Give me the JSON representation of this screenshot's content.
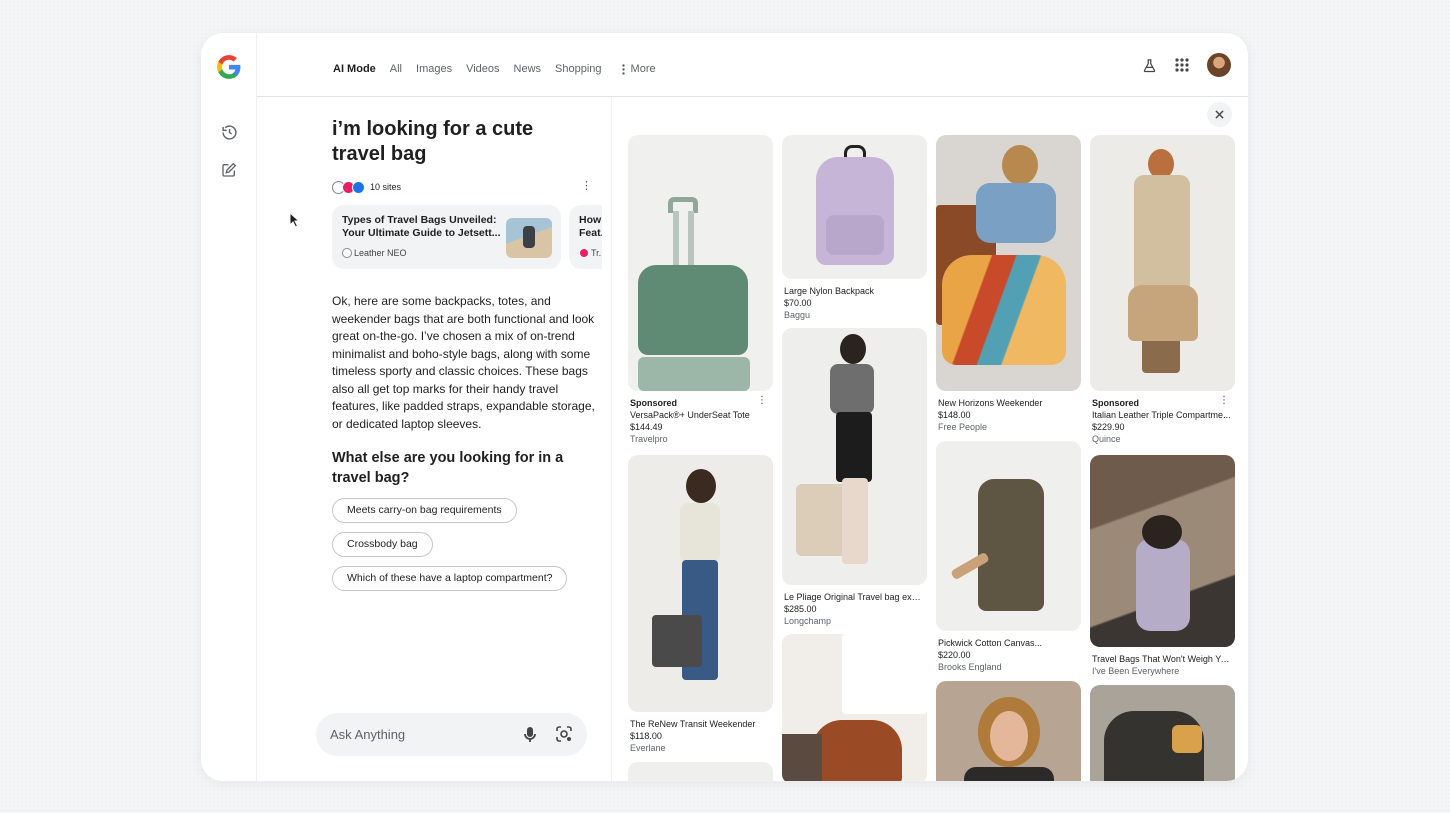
{
  "header": {
    "tabs": [
      {
        "label": "AI Mode",
        "active": true
      },
      {
        "label": "All"
      },
      {
        "label": "Images"
      },
      {
        "label": "Videos"
      },
      {
        "label": "News"
      },
      {
        "label": "Shopping"
      }
    ],
    "more_label": "More"
  },
  "conversation": {
    "query": "i’m looking for a cute travel bag",
    "sites_label": "10 sites",
    "sources": [
      {
        "title": "Types of Travel Bags Unveiled: Your Ultimate Guide to Jetsett...",
        "site": "Leather NEO"
      },
      {
        "title": "How Feat...",
        "site": "Tr..."
      }
    ],
    "answer": "Ok, here are some backpacks, totes, and weekender bags that are both functional and look great on-the-go. I’ve chosen a mix of on-trend minimalist and boho-style bags, along with some timeless sporty and classic choices. These bags also all get top marks for their handy travel features, like padded straps, expandable storage, or dedicated laptop sleeves.",
    "followup_heading": "What else are you looking for in a travel bag?",
    "chips": [
      "Meets carry-on bag requirements",
      "Crossbody bag",
      "Which of these have a laptop compartment?"
    ]
  },
  "askbar": {
    "placeholder": "Ask Anything"
  },
  "products": [
    {
      "sponsored": "Sponsored",
      "name": "VersaPack®+ UnderSeat Tote",
      "price": "$144.49",
      "store": "Travelpro"
    },
    {
      "sponsored": "",
      "name": "The ReNew Transit Weekender",
      "price": "$118.00",
      "store": "Everlane"
    },
    {
      "sponsored": "",
      "name": "Large Nylon Backpack",
      "price": "$70.00",
      "store": "Baggu"
    },
    {
      "sponsored": "",
      "name": "Le Pliage Original Travel bag expa...",
      "price": "$285.00",
      "store": "Longchamp"
    },
    {
      "sponsored": "",
      "name": "New Horizons Weekender",
      "price": "$148.00",
      "store": "Free People"
    },
    {
      "sponsored": "",
      "name": "Pickwick Cotton Canvas...",
      "price": "$220.00",
      "store": "Brooks England"
    },
    {
      "sponsored": "Sponsored",
      "name": "Italian Leather Triple Compartme...",
      "price": "$229.90",
      "store": "Quince"
    },
    {
      "sponsored": "",
      "name": "Travel Bags That Won't Weigh Yo...",
      "price": "",
      "store": "I've Been Everywhere"
    }
  ],
  "colors": {
    "accent_blue": "#4285f4",
    "accent_red": "#ea4335",
    "accent_yellow": "#fbbc05",
    "accent_green": "#34a853",
    "chip_border": "#c7c7c7",
    "surface": "#f1f3f4"
  },
  "icons": [
    "google-logo-icon",
    "history-icon",
    "new-chat-icon",
    "labs-flask-icon",
    "apps-grid-icon",
    "more-dots-icon",
    "mic-icon",
    "lens-camera-icon",
    "close-icon",
    "kebab-icon",
    "cursor-icon"
  ]
}
